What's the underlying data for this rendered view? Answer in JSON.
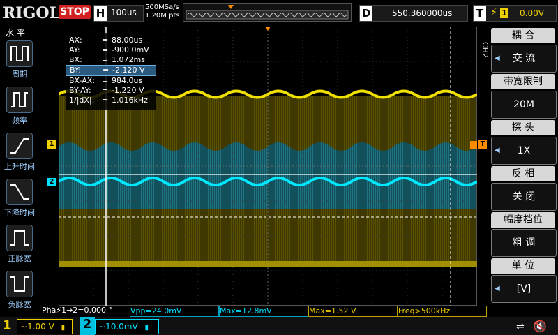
{
  "header": {
    "logo": "RIGOL",
    "run_state": "STOP",
    "horizontal": {
      "key": "H",
      "scale": "100us"
    },
    "sample_rate": "500MSa/s",
    "memory_depth": "1.20M pts",
    "delay": {
      "key": "D",
      "value": "550.360000us"
    },
    "trigger": {
      "key": "T",
      "edge_icon": "rising-edge-icon",
      "source": "1",
      "level": "0.00V"
    }
  },
  "left_menu": {
    "title": "水 平",
    "items": [
      {
        "label": "周期",
        "icon": "period-icon"
      },
      {
        "label": "频率",
        "icon": "frequency-icon"
      },
      {
        "label": "上升时间",
        "icon": "rise-time-icon"
      },
      {
        "label": "下降时间",
        "icon": "fall-time-icon"
      },
      {
        "label": "正脉宽",
        "icon": "positive-width-icon"
      },
      {
        "label": "负脉宽",
        "icon": "negative-width-icon"
      }
    ]
  },
  "right_menu": {
    "channel_tag": "CH2",
    "items": [
      {
        "title": "耦 合",
        "value": "交 流",
        "has_arrow": true
      },
      {
        "title": "带宽限制",
        "value": "20M",
        "has_arrow": false
      },
      {
        "title": "探 头",
        "value": "1X",
        "has_arrow": true
      },
      {
        "title": "反 相",
        "value": "关 闭",
        "has_arrow": false
      },
      {
        "title": "幅度档位",
        "value": "粗 调",
        "has_arrow": false
      },
      {
        "title": "单 位",
        "value": "[V]",
        "has_arrow": true
      }
    ]
  },
  "cursor_table": [
    {
      "key": "AX:",
      "value": "88.00us",
      "selected": false
    },
    {
      "key": "AY:",
      "value": "-900.0mV",
      "selected": false
    },
    {
      "key": "BX:",
      "value": "1.072ms",
      "selected": false
    },
    {
      "key": "BY:",
      "value": "-2.120 V",
      "selected": true
    },
    {
      "key": "BX-AX:",
      "value": "984.0us",
      "selected": false
    },
    {
      "key": "BY-AY:",
      "value": "-1.220 V",
      "selected": false
    },
    {
      "key": "1/|dX|:",
      "value": "1.016kHz",
      "selected": false
    }
  ],
  "measurements": [
    {
      "text": "Pha⚡1→2=0.000 °",
      "color": "#ffffff"
    },
    {
      "text": "Vpp=24.0mV",
      "color": "#00e0ff"
    },
    {
      "text": "Max=12.8mV",
      "color": "#00e0ff"
    },
    {
      "text": "Max=1.52 V",
      "color": "#f0d000"
    },
    {
      "text": "Freq>500kHz",
      "color": "#f0d000"
    }
  ],
  "channels": [
    {
      "number": "1",
      "coupling_icon": "ac-coupling-icon",
      "scale": "1.00 V",
      "color": "#f0d000"
    },
    {
      "number": "2",
      "coupling_icon": "ac-coupling-icon",
      "scale": "10.0mV",
      "color": "#00e0ff"
    }
  ],
  "markers": {
    "ch1": "1",
    "ch2": "2",
    "trig": "T"
  },
  "colors": {
    "ch1": "#f0d000",
    "ch2": "#00e0ff",
    "stop": "#d02020",
    "menu_accent": "#9fd0ff"
  }
}
